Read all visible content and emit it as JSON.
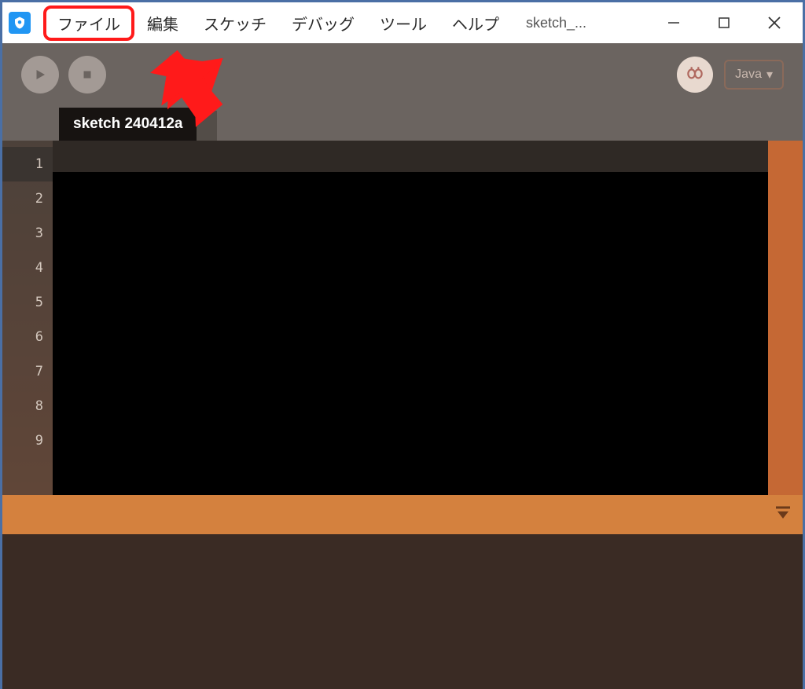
{
  "menubar": {
    "items": [
      "ファイル",
      "編集",
      "スケッチ",
      "デバッグ",
      "ツール",
      "ヘルプ"
    ],
    "highlighted_index": 0
  },
  "window": {
    "title": "sketch_..."
  },
  "toolbar": {
    "mode": "Java"
  },
  "tabs": {
    "active": "sketch 240412a"
  },
  "editor": {
    "line_numbers": [
      "1",
      "2",
      "3",
      "4",
      "5",
      "6",
      "7",
      "8",
      "9"
    ],
    "current_line": 1
  },
  "annotation": {
    "type": "arrow",
    "color": "#ff1a1a",
    "target": "menu-file"
  }
}
